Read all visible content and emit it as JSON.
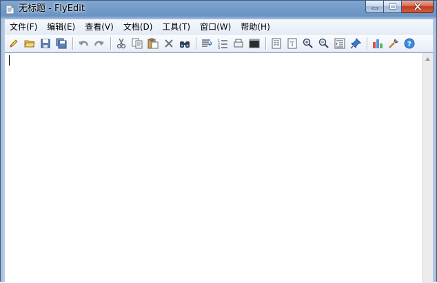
{
  "window": {
    "title": "无标题 - FlyEdit",
    "icon": "document-icon"
  },
  "caption_buttons": [
    "minimize",
    "maximize",
    "close"
  ],
  "menu": [
    "文件(F)",
    "编辑(E)",
    "查看(V)",
    "文档(D)",
    "工具(T)",
    "窗口(W)",
    "帮助(H)"
  ],
  "toolbar_icons": [
    "new-icon",
    "open-icon",
    "save-icon",
    "save-all-icon",
    "undo-icon",
    "redo-icon",
    "cut-icon",
    "copy-icon",
    "paste-icon",
    "delete-icon",
    "find-icon",
    "word-wrap-icon",
    "line-numbers-icon",
    "print-icon",
    "console-icon",
    "properties-icon",
    "document-info-icon",
    "zoom-in-icon",
    "zoom-out-icon",
    "indent-icon",
    "pin-icon",
    "statistics-icon",
    "tools-icon",
    "help-icon"
  ],
  "editor": {
    "content": ""
  },
  "colors": {
    "titlebar": "#6a93c2",
    "close_button": "#c2391c",
    "menubar": "#e4ecf6"
  }
}
